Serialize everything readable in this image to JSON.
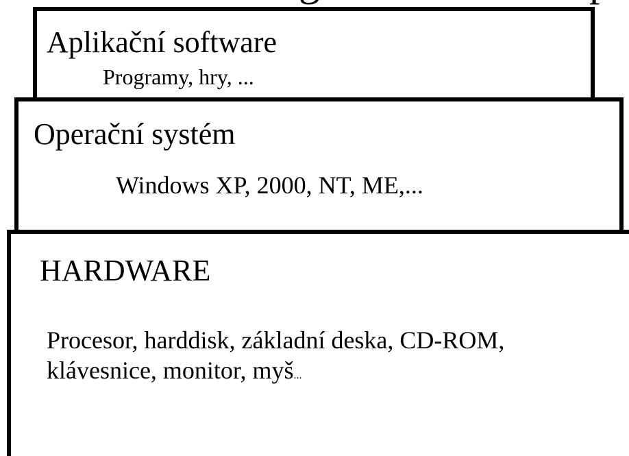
{
  "heading_fragment": {
    "left": "g",
    "right": "p"
  },
  "layers": {
    "application": {
      "title": "Aplikační software",
      "subtitle": "Programy, hry, ..."
    },
    "operating_system": {
      "title": "Operační systém",
      "subtitle": "Windows XP, 2000, NT, ME,..."
    },
    "hardware": {
      "title": "HARDWARE",
      "subtitle_line1": "Procesor, harddisk, základní deska, CD-ROM,",
      "subtitle_line2": "klávesnice, monitor, myš",
      "subtitle_line2_suffix": "..."
    }
  },
  "colors": {
    "background": "#ffffff",
    "text": "#000000",
    "border": "#000000"
  }
}
